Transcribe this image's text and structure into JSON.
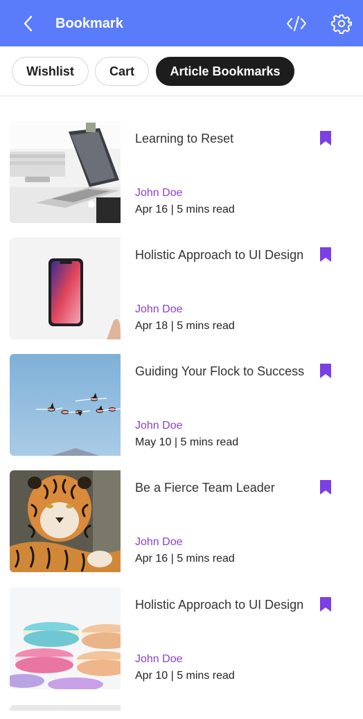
{
  "header": {
    "title": "Bookmark",
    "background": "#5b7cfa",
    "back_icon": "chevron-left-icon",
    "code_icon": "code-icon",
    "settings_icon": "gear-icon"
  },
  "tabs": [
    {
      "label": "Wishlist",
      "active": false
    },
    {
      "label": "Cart",
      "active": false
    },
    {
      "label": "Article Bookmarks",
      "active": true
    }
  ],
  "accent": "#8a3fd1",
  "bookmark_color": "#7b3fe4",
  "articles": [
    {
      "title": "Learning to Reset",
      "author": "John Doe",
      "meta": "Apr 16 | 5 mins read",
      "image": "laptop-on-desk"
    },
    {
      "title": "Holistic Approach to UI Design",
      "author": "John Doe",
      "meta": "Apr 18 | 5 mins read",
      "image": "smartphone"
    },
    {
      "title": "Guiding Your Flock to Success",
      "author": "John Doe",
      "meta": "May 10 | 5 mins read",
      "image": "flamingos-flying"
    },
    {
      "title": "Be a Fierce Team Leader",
      "author": "John Doe",
      "meta": "Apr 16 | 5 mins read",
      "image": "tiger"
    },
    {
      "title": "Holistic Approach to UI Design",
      "author": "John Doe",
      "meta": "Apr 10 | 5 mins read",
      "image": "macarons"
    }
  ]
}
